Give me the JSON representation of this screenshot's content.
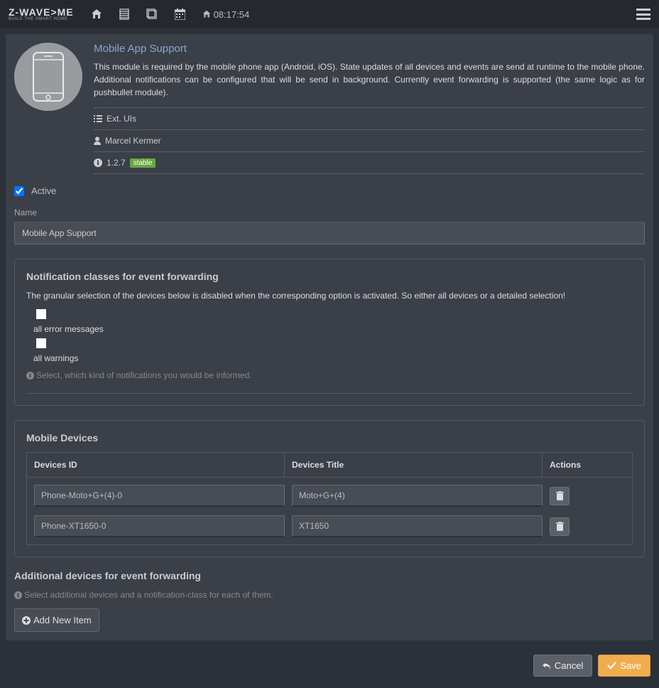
{
  "brand": {
    "name": "Z-WAVE>ME",
    "tagline": "BUILD THE SMART HOME"
  },
  "clock": "08:17:54",
  "module": {
    "title": "Mobile App Support",
    "description": "This module is required by the mobile phone app (Android, iOS). State updates of all devices and events are send at runtime to the mobile phone. Additional notifications can be configured that will be send in background. Currently event forwarding is supported (the same logic as for pushbullet module).",
    "category": "Ext. UIs",
    "author": "Marcel Kermer",
    "version": "1.2.7",
    "maturity": "stable"
  },
  "form": {
    "active_label": "Active",
    "active_checked": true,
    "name_label": "Name",
    "name_value": "Mobile App Support"
  },
  "notif": {
    "title": "Notification classes for event forwarding",
    "desc": "The granular selection of the devices below is disabled when the corresponding option is activated. So either all devices or a detailed selection!",
    "opt_errors": "all error messages",
    "opt_warnings": "all warnings",
    "help": "Select, which kind of notifications you would be informed."
  },
  "devices": {
    "title": "Mobile Devices",
    "col_id": "Devices ID",
    "col_title": "Devices Title",
    "col_actions": "Actions",
    "rows": [
      {
        "id": "Phone-Moto+G+(4)-0",
        "title": "Moto+G+(4)"
      },
      {
        "id": "Phone-XT1650-0",
        "title": "XT1650"
      }
    ]
  },
  "additional": {
    "title": "Additional devices for event forwarding",
    "help": "Select additional devices and a notification-class for each of them.",
    "add_btn": "Add New Item"
  },
  "footer": {
    "cancel": "Cancel",
    "save": "Save"
  }
}
